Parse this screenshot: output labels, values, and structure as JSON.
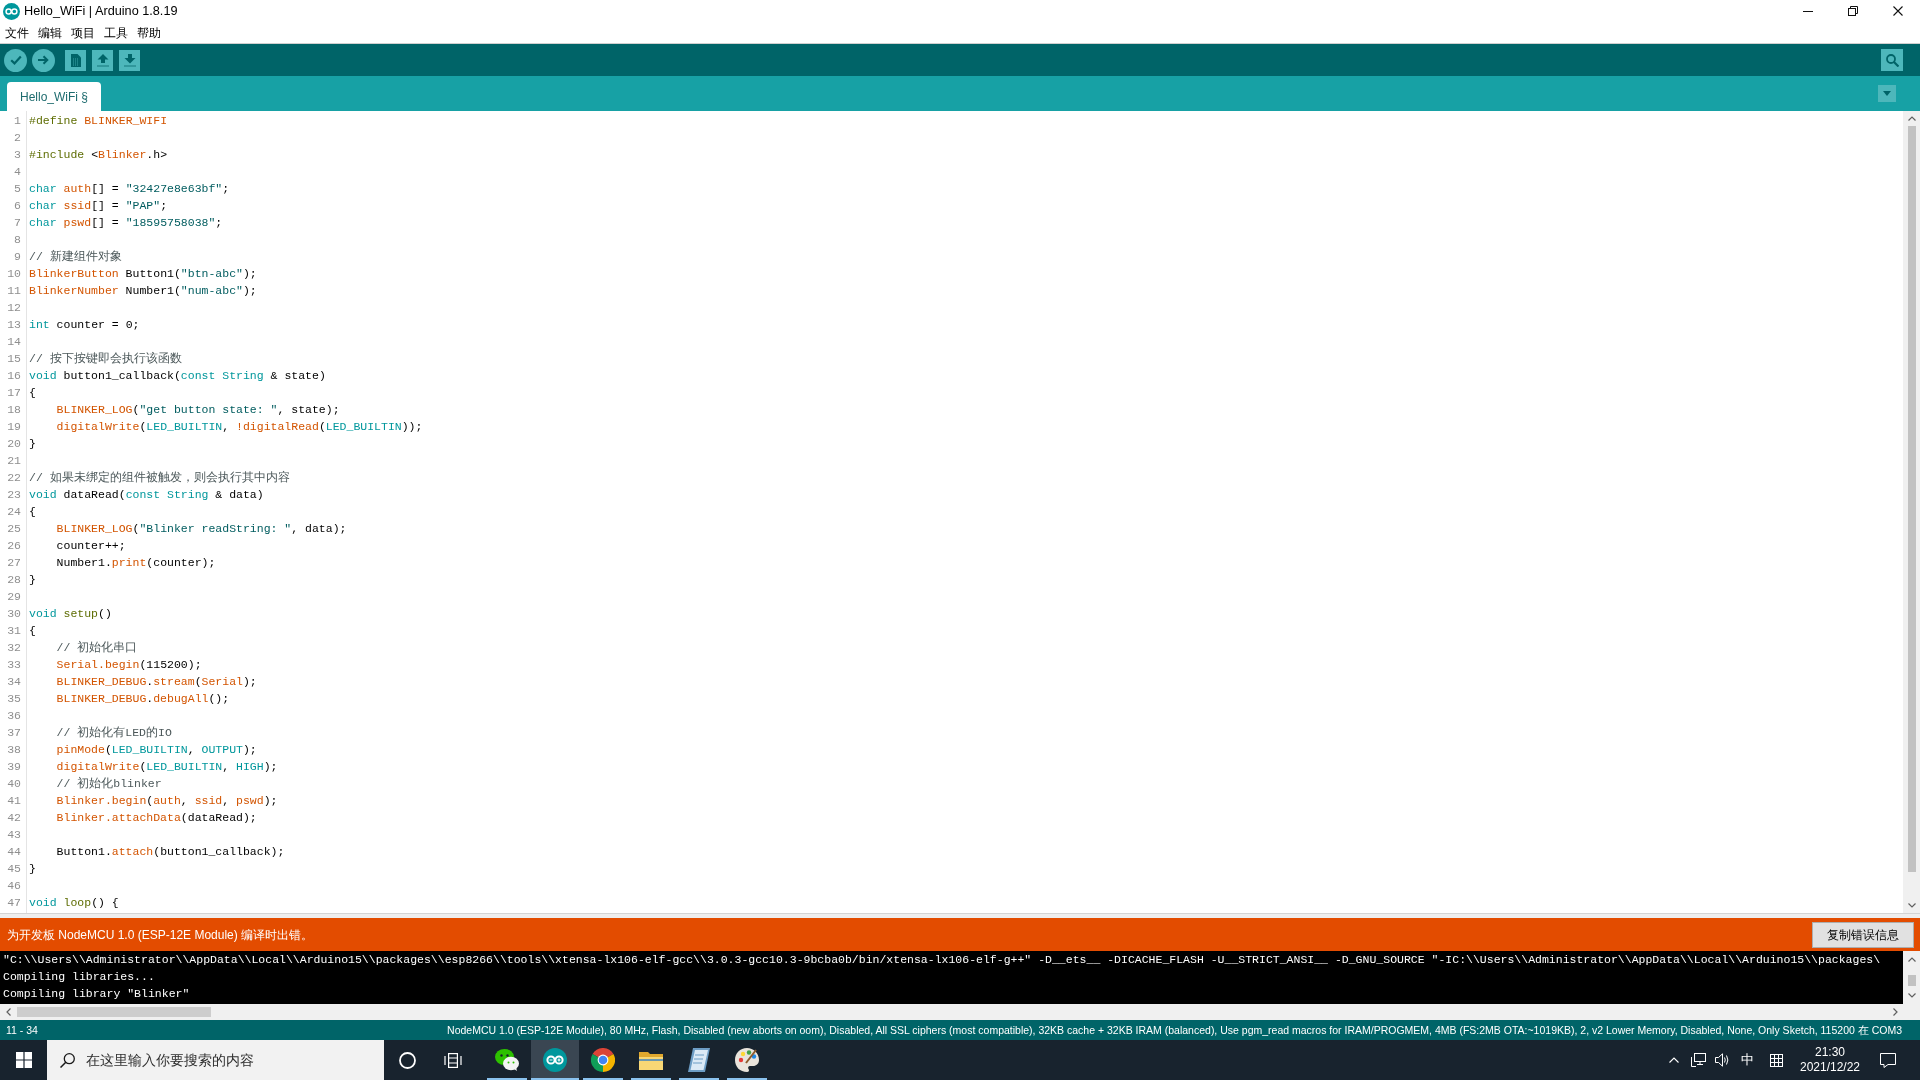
{
  "window": {
    "title": "Hello_WiFi | Arduino 1.8.19"
  },
  "menu_bar": {
    "items": [
      "文件",
      "编辑",
      "项目",
      "工具",
      "帮助"
    ]
  },
  "tabs": [
    {
      "label": "Hello_WiFi §",
      "selected": true
    }
  ],
  "editor": {
    "lines": [
      {
        "number": "1",
        "indented": false,
        "tokens": [
          {
            "kind": "structure",
            "text": "#define "
          },
          {
            "kind": "function",
            "text": "BLINKER_WIFI"
          }
        ]
      },
      {
        "number": "2"
      },
      {
        "number": "3",
        "indented": false,
        "tokens": [
          {
            "kind": "structure",
            "text": "#include "
          },
          {
            "kind": "plain",
            "text": "<"
          },
          {
            "kind": "function",
            "text": "Blinker"
          },
          {
            "kind": "plain",
            "text": ".h>"
          }
        ]
      },
      {
        "number": "4"
      },
      {
        "number": "5",
        "indented": false,
        "tokens": [
          {
            "kind": "keyword",
            "text": "char "
          },
          {
            "kind": "function",
            "text": "auth"
          },
          {
            "kind": "plain",
            "text": "[] = "
          },
          {
            "kind": "string",
            "text": "\"32427e8e63bf\""
          },
          {
            "kind": "plain",
            "text": ";"
          }
        ]
      },
      {
        "number": "6",
        "indented": false,
        "tokens": [
          {
            "kind": "keyword",
            "text": "char "
          },
          {
            "kind": "function",
            "text": "ssid"
          },
          {
            "kind": "plain",
            "text": "[] = "
          },
          {
            "kind": "string",
            "text": "\"PAP\""
          },
          {
            "kind": "plain",
            "text": ";"
          }
        ]
      },
      {
        "number": "7",
        "indented": false,
        "tokens": [
          {
            "kind": "keyword",
            "text": "char "
          },
          {
            "kind": "function",
            "text": "pswd"
          },
          {
            "kind": "plain",
            "text": "[] = "
          },
          {
            "kind": "string",
            "text": "\"18595758038\""
          },
          {
            "kind": "plain",
            "text": ";"
          }
        ]
      },
      {
        "number": "8"
      },
      {
        "number": "9",
        "indented": false,
        "tokens": [
          {
            "kind": "comment",
            "text": "// 新建组件对象"
          }
        ]
      },
      {
        "number": "10",
        "indented": false,
        "tokens": [
          {
            "kind": "function",
            "text": "BlinkerButton"
          },
          {
            "kind": "plain",
            "text": " Button1("
          },
          {
            "kind": "string",
            "text": "\"btn-abc\""
          },
          {
            "kind": "plain",
            "text": ");"
          }
        ]
      },
      {
        "number": "11",
        "indented": false,
        "tokens": [
          {
            "kind": "function",
            "text": "BlinkerNumber"
          },
          {
            "kind": "plain",
            "text": " Number1("
          },
          {
            "kind": "string",
            "text": "\"num-abc\""
          },
          {
            "kind": "plain",
            "text": ");"
          }
        ]
      },
      {
        "number": "12"
      },
      {
        "number": "13",
        "indented": false,
        "tokens": [
          {
            "kind": "keyword",
            "text": "int"
          },
          {
            "kind": "plain",
            "text": " counter = 0;"
          }
        ]
      },
      {
        "number": "14"
      },
      {
        "number": "15",
        "indented": false,
        "tokens": [
          {
            "kind": "comment",
            "text": "// 按下按键即会执行该函数"
          }
        ]
      },
      {
        "number": "16",
        "indented": false,
        "tokens": [
          {
            "kind": "keyword",
            "text": "void"
          },
          {
            "kind": "plain",
            "text": " button1_callback("
          },
          {
            "kind": "keyword",
            "text": "const String"
          },
          {
            "kind": "plain",
            "text": " & state)"
          }
        ]
      },
      {
        "number": "17",
        "indented": false,
        "tokens": [
          {
            "kind": "plain",
            "text": "{"
          }
        ]
      },
      {
        "number": "18",
        "indented": true,
        "tokens": [
          {
            "kind": "function",
            "text": "BLINKER_LOG"
          },
          {
            "kind": "plain",
            "text": "("
          },
          {
            "kind": "string",
            "text": "\"get button state: \""
          },
          {
            "kind": "plain",
            "text": ", state);"
          }
        ]
      },
      {
        "number": "19",
        "indented": true,
        "tokens": [
          {
            "kind": "function",
            "text": "digitalWrite"
          },
          {
            "kind": "plain",
            "text": "("
          },
          {
            "kind": "keyword",
            "text": "LED_BUILTIN"
          },
          {
            "kind": "plain",
            "text": ", "
          },
          {
            "kind": "function",
            "text": "!digitalRead"
          },
          {
            "kind": "plain",
            "text": "("
          },
          {
            "kind": "keyword",
            "text": "LED_BUILTIN"
          },
          {
            "kind": "plain",
            "text": "));"
          }
        ]
      },
      {
        "number": "20",
        "indented": false,
        "tokens": [
          {
            "kind": "plain",
            "text": "}"
          }
        ]
      },
      {
        "number": "21"
      },
      {
        "number": "22",
        "indented": false,
        "tokens": [
          {
            "kind": "comment",
            "text": "// 如果未绑定的组件被触发，则会执行其中内容"
          }
        ]
      },
      {
        "number": "23",
        "indented": false,
        "tokens": [
          {
            "kind": "keyword",
            "text": "void"
          },
          {
            "kind": "plain",
            "text": " dataRead("
          },
          {
            "kind": "keyword",
            "text": "const String"
          },
          {
            "kind": "plain",
            "text": " & data)"
          }
        ]
      },
      {
        "number": "24",
        "indented": false,
        "tokens": [
          {
            "kind": "plain",
            "text": "{"
          }
        ]
      },
      {
        "number": "25",
        "indented": true,
        "tokens": [
          {
            "kind": "function",
            "text": "BLINKER_LOG"
          },
          {
            "kind": "plain",
            "text": "("
          },
          {
            "kind": "string",
            "text": "\"Blinker readString: \""
          },
          {
            "kind": "plain",
            "text": ", data);"
          }
        ]
      },
      {
        "number": "26",
        "indented": true,
        "tokens": [
          {
            "kind": "plain",
            "text": "counter++;"
          }
        ]
      },
      {
        "number": "27",
        "indented": true,
        "tokens": [
          {
            "kind": "plain",
            "text": "Number1."
          },
          {
            "kind": "function",
            "text": "print"
          },
          {
            "kind": "plain",
            "text": "(counter);"
          }
        ]
      },
      {
        "number": "28",
        "indented": false,
        "tokens": [
          {
            "kind": "plain",
            "text": "}"
          }
        ]
      },
      {
        "number": "29"
      },
      {
        "number": "30",
        "indented": false,
        "tokens": [
          {
            "kind": "keyword",
            "text": "void "
          },
          {
            "kind": "structure",
            "text": "setup"
          },
          {
            "kind": "plain",
            "text": "()"
          }
        ]
      },
      {
        "number": "31",
        "indented": false,
        "tokens": [
          {
            "kind": "plain",
            "text": "{"
          }
        ]
      },
      {
        "number": "32",
        "indented": true,
        "tokens": [
          {
            "kind": "comment",
            "text": "// 初始化串口"
          }
        ]
      },
      {
        "number": "33",
        "indented": true,
        "tokens": [
          {
            "kind": "function",
            "text": "Serial.begin"
          },
          {
            "kind": "plain",
            "text": "(115200);"
          }
        ]
      },
      {
        "number": "34",
        "indented": true,
        "tokens": [
          {
            "kind": "function",
            "text": "BLINKER_DEBUG"
          },
          {
            "kind": "plain",
            "text": "."
          },
          {
            "kind": "function",
            "text": "stream"
          },
          {
            "kind": "plain",
            "text": "("
          },
          {
            "kind": "function",
            "text": "Serial"
          },
          {
            "kind": "plain",
            "text": ");"
          }
        ]
      },
      {
        "number": "35",
        "indented": true,
        "tokens": [
          {
            "kind": "function",
            "text": "BLINKER_DEBUG"
          },
          {
            "kind": "plain",
            "text": "."
          },
          {
            "kind": "function",
            "text": "debugAll"
          },
          {
            "kind": "plain",
            "text": "();"
          }
        ]
      },
      {
        "number": "36"
      },
      {
        "number": "37",
        "indented": true,
        "tokens": [
          {
            "kind": "comment",
            "text": "// 初始化有LED的IO"
          }
        ]
      },
      {
        "number": "38",
        "indented": true,
        "tokens": [
          {
            "kind": "function",
            "text": "pinMode"
          },
          {
            "kind": "plain",
            "text": "("
          },
          {
            "kind": "keyword",
            "text": "LED_BUILTIN"
          },
          {
            "kind": "plain",
            "text": ", "
          },
          {
            "kind": "keyword",
            "text": "OUTPUT"
          },
          {
            "kind": "plain",
            "text": ");"
          }
        ]
      },
      {
        "number": "39",
        "indented": true,
        "tokens": [
          {
            "kind": "function",
            "text": "digitalWrite"
          },
          {
            "kind": "plain",
            "text": "("
          },
          {
            "kind": "keyword",
            "text": "LED_BUILTIN"
          },
          {
            "kind": "plain",
            "text": ", "
          },
          {
            "kind": "keyword",
            "text": "HIGH"
          },
          {
            "kind": "plain",
            "text": ");"
          }
        ]
      },
      {
        "number": "40",
        "indented": true,
        "tokens": [
          {
            "kind": "comment",
            "text": "// 初始化blinker"
          }
        ]
      },
      {
        "number": "41",
        "indented": true,
        "tokens": [
          {
            "kind": "function",
            "text": "Blinker.begin"
          },
          {
            "kind": "plain",
            "text": "("
          },
          {
            "kind": "function",
            "text": "auth"
          },
          {
            "kind": "plain",
            "text": ", "
          },
          {
            "kind": "function",
            "text": "ssid"
          },
          {
            "kind": "plain",
            "text": ", "
          },
          {
            "kind": "function",
            "text": "pswd"
          },
          {
            "kind": "plain",
            "text": ");"
          }
        ]
      },
      {
        "number": "42",
        "indented": true,
        "tokens": [
          {
            "kind": "function",
            "text": "Blinker.attachData"
          },
          {
            "kind": "plain",
            "text": "(dataRead);"
          }
        ]
      },
      {
        "number": "43"
      },
      {
        "number": "44",
        "indented": true,
        "tokens": [
          {
            "kind": "plain",
            "text": "Button1."
          },
          {
            "kind": "function",
            "text": "attach"
          },
          {
            "kind": "plain",
            "text": "(button1_callback);"
          }
        ]
      },
      {
        "number": "45",
        "indented": false,
        "tokens": [
          {
            "kind": "plain",
            "text": "}"
          }
        ]
      },
      {
        "number": "46"
      },
      {
        "number": "47",
        "indented": false,
        "tokens": [
          {
            "kind": "keyword",
            "text": "void "
          },
          {
            "kind": "structure",
            "text": "loop"
          },
          {
            "kind": "plain",
            "text": "() {"
          }
        ]
      }
    ]
  },
  "error_bar": {
    "message": "为开发板 NodeMCU 1.0 (ESP-12E Module) 编译时出错。",
    "button": "复制错误信息"
  },
  "console": {
    "lines": [
      "\"C:\\\\Users\\\\Administrator\\\\AppData\\\\Local\\\\Arduino15\\\\packages\\\\esp8266\\\\tools\\\\xtensa-lx106-elf-gcc\\\\3.0.3-gcc10.3-9bcba0b/bin/xtensa-lx106-elf-g++\" -D__ets__ -DICACHE_FLASH -U__STRICT_ANSI__ -D_GNU_SOURCE \"-IC:\\\\Users\\\\Administrator\\\\AppData\\\\Local\\\\Arduino15\\\\packages\\",
      "Compiling libraries...",
      "Compiling library \"Blinker\""
    ]
  },
  "status_bar": {
    "position": "11 - 34",
    "board": "NodeMCU 1.0 (ESP-12E Module), 80 MHz, Flash, Disabled (new aborts on oom), Disabled, All SSL ciphers (most compatible), 32KB cache + 32KB IRAM (balanced), Use pgm_read macros for IRAM/PROGMEM, 4MB (FS:2MB OTA:~1019KB), 2, v2 Lower Memory, Disabled, None, Only Sketch, 115200 在 COM3"
  },
  "taskbar": {
    "search": {
      "placeholder": "在这里输入你要搜索的内容"
    },
    "apps": [
      {
        "kind": "chat",
        "running": true,
        "selected": false
      },
      {
        "kind": "infinity",
        "running": true,
        "selected": true
      },
      {
        "kind": "browser",
        "running": true,
        "selected": false
      },
      {
        "kind": "folder",
        "running": true,
        "selected": false
      },
      {
        "kind": "notebook",
        "running": true,
        "selected": false
      },
      {
        "kind": "palette",
        "running": true,
        "selected": false
      }
    ],
    "tray": {
      "input_mode": "中",
      "time": "21:30",
      "date": "2021/12/22"
    }
  }
}
